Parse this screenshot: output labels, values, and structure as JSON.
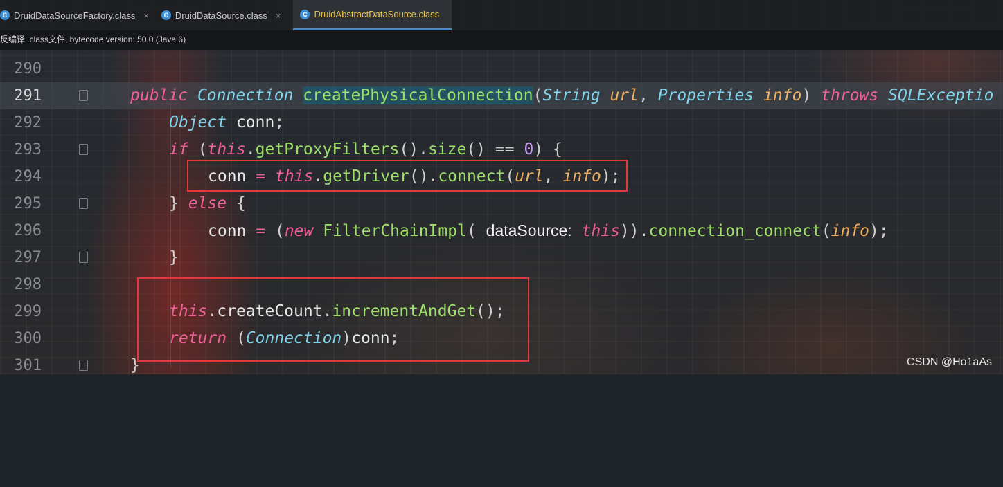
{
  "tabs": [
    {
      "label": "DruidDataSourceFactory.class",
      "active": false
    },
    {
      "label": "DruidDataSource.class",
      "active": false
    },
    {
      "label": "DruidAbstractDataSource.class",
      "active": true
    }
  ],
  "infobar": {
    "text": "反编译 .class文件, bytecode version: 50.0 (Java 6)"
  },
  "lines": {
    "l290": {
      "num": "290"
    },
    "l291": {
      "num": "291",
      "kw_public": "public",
      "type_conn": "Connection",
      "method": "createPhysicalConnection",
      "paren_open": "(",
      "type_string": "String",
      "p_url": "url",
      "comma": ",",
      "type_props": "Properties",
      "p_info": "info",
      "paren_close": ")",
      "kw_throws": "throws",
      "type_exc": "SQLExceptio"
    },
    "l292": {
      "num": "292",
      "type_obj": "Object",
      "var": "conn",
      "semi": ";"
    },
    "l293": {
      "num": "293",
      "kw_if": "if",
      "open": "(",
      "kw_this": "this",
      "dot1": ".",
      "fn1": "getProxyFilters",
      "call1": "()",
      "dot2": ".",
      "fn2": "size",
      "call2": "()",
      "eq": "==",
      "zero": "0",
      "close": ")",
      "brace": "{"
    },
    "l294": {
      "num": "294",
      "var": "conn",
      "assign": "=",
      "kw_this": "this",
      "dot1": ".",
      "fn1": "getDriver",
      "call1": "()",
      "dot2": ".",
      "fn2": "connect",
      "open": "(",
      "p_url": "url",
      "comma": ",",
      "p_info": "info",
      "close": ");"
    },
    "l295": {
      "num": "295",
      "brace_close": "}",
      "kw_else": "else",
      "brace_open": "{"
    },
    "l296": {
      "num": "296",
      "var": "conn",
      "assign": "=",
      "open": "(",
      "kw_new": "new",
      "cls": "FilterChainImpl",
      "open2": "(",
      "hint": "dataSource:",
      "kw_this": "this",
      "close2": "))",
      "dot": ".",
      "fn": "connection_connect",
      "open3": "(",
      "p_info": "info",
      "close3": ");"
    },
    "l297": {
      "num": "297",
      "brace": "}"
    },
    "l298": {
      "num": "298"
    },
    "l299": {
      "num": "299",
      "kw_this": "this",
      "dot1": ".",
      "field": "createCount",
      "dot2": ".",
      "fn": "incrementAndGet",
      "call": "();"
    },
    "l300": {
      "num": "300",
      "kw_return": "return",
      "open": "(",
      "type": "Connection",
      "close": ")",
      "var": "conn",
      "semi": ";"
    },
    "l301": {
      "num": "301",
      "brace": "}"
    }
  },
  "watermark": "CSDN @Ho1aAs",
  "colors": {
    "keyword": "#f0609a",
    "type": "#7fd3ea",
    "method": "#9fe06a",
    "param": "#f0b060",
    "number": "#c89cf0",
    "highlight_box": "#e23a3a",
    "active_tab": "#e7c24a"
  }
}
